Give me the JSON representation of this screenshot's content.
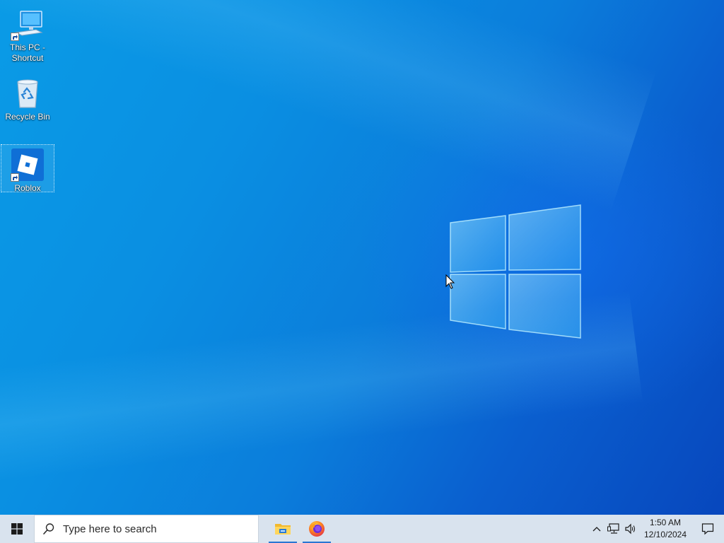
{
  "desktop": {
    "icons": [
      {
        "label": "This PC - Shortcut",
        "icon": "computer-monitor-icon",
        "shortcut": true
      },
      {
        "label": "Recycle Bin",
        "icon": "recycle-bin-icon",
        "shortcut": false
      },
      {
        "label": "Roblox",
        "icon": "roblox-icon",
        "shortcut": true,
        "selected": true
      }
    ],
    "wallpaper": "windows-10-hero",
    "accent_color": "#0a8fe2"
  },
  "taskbar": {
    "start_icon": "windows-start-icon",
    "search": {
      "placeholder": "Type here to search",
      "icon": "search-icon"
    },
    "pinned": [
      {
        "name": "File Explorer",
        "icon": "file-explorer-icon",
        "running": true
      },
      {
        "name": "Firefox",
        "icon": "firefox-icon",
        "running": true
      }
    ],
    "tray": {
      "icons": [
        "chevron-up-icon",
        "network-icon",
        "volume-icon"
      ],
      "time": "1:50 AM",
      "date": "12/10/2024",
      "notification_icon": "notification-icon"
    }
  }
}
